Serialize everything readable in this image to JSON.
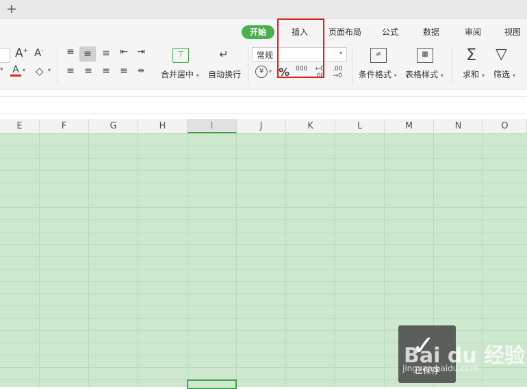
{
  "titlebar": {
    "new_tab_symbol": "+"
  },
  "ribbon_tabs": [
    "开始",
    "插入",
    "页面布局",
    "公式",
    "数据",
    "审阅",
    "视图"
  ],
  "active_tab": "开始",
  "font_group": {
    "font_color_letter": "A",
    "increase_font": "A",
    "decrease_font": "A"
  },
  "alignment_group": {
    "merge_center": "合并居中",
    "wrap_text": "自动换行"
  },
  "number_group": {
    "format_value": "常规",
    "percent": "%",
    "thousands": "000",
    "dec_increase_top": "←0",
    "dec_increase_bottom": ".00",
    "dec_decrease_top": ".00",
    "dec_decrease_bottom": "→0",
    "currency": "¥"
  },
  "styles_group": {
    "conditional_format": "条件格式",
    "table_style": "表格样式"
  },
  "editing_group": {
    "sum": "求和",
    "filter": "筛选"
  },
  "columns": [
    "E",
    "F",
    "G",
    "H",
    "I",
    "J",
    "K",
    "L",
    "M",
    "N",
    "O"
  ],
  "selected_column": "I",
  "toast": {
    "text": "已保存"
  },
  "watermark": {
    "brand": "Bai du 经验",
    "url": "jingyan.baidu.com"
  },
  "colors": {
    "accent": "#4caf50",
    "highlight": "#e02020",
    "sheet_bg": "#cde8cf"
  }
}
